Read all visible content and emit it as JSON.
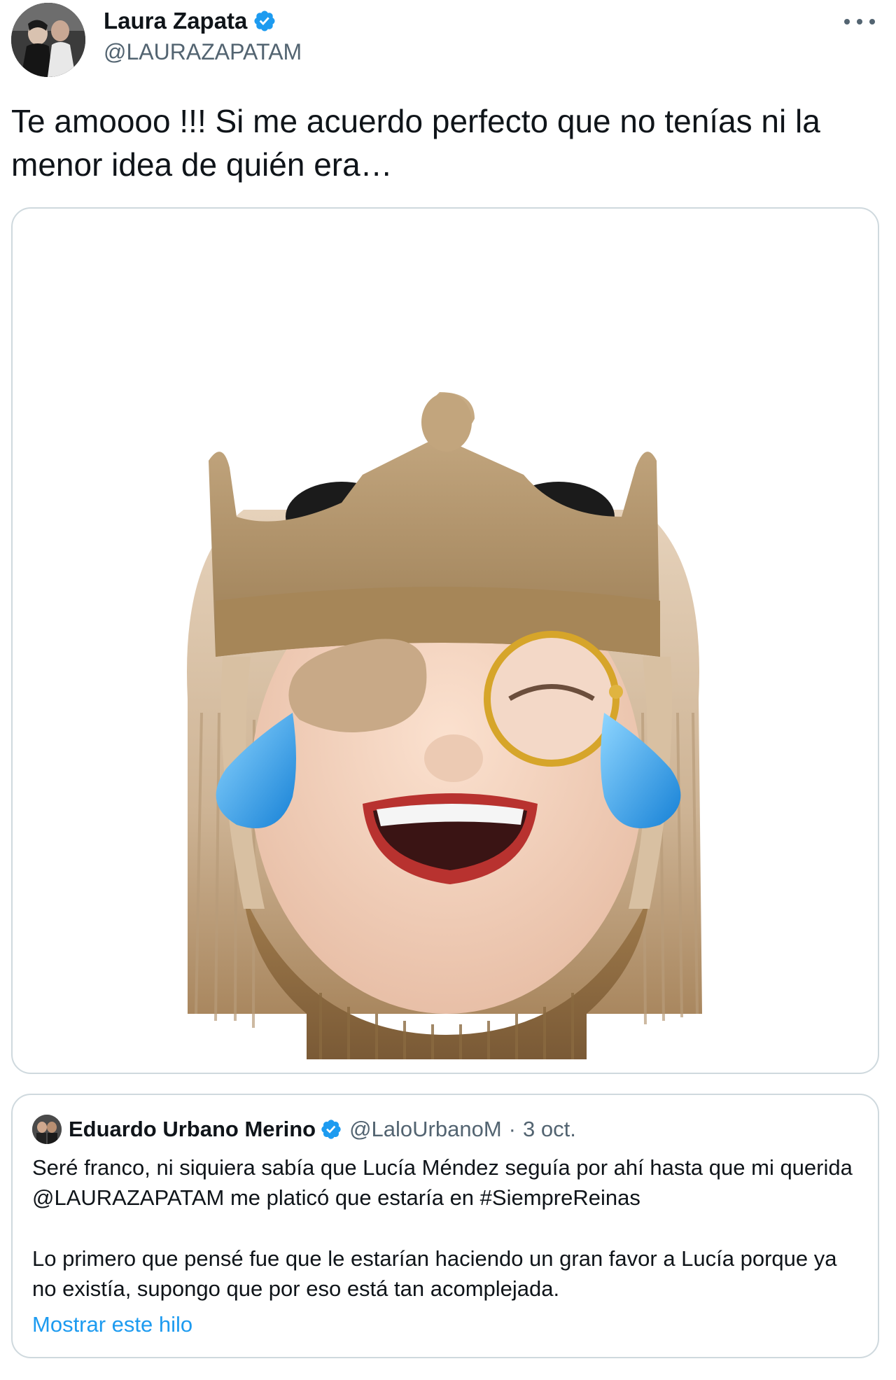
{
  "author": {
    "name": "Laura Zapata",
    "handle": "@LAURAZAPATAM",
    "verified": true,
    "verified_color": "#1d9bf0"
  },
  "icons": {
    "more": "more-options-icon",
    "verified": "verified-badge-icon"
  },
  "tweet": {
    "text": "Te amoooo !!! Si me acuerdo perfecto que no tenías ni la menor idea de quién era…"
  },
  "media": {
    "kind": "memoji-image",
    "description_icon": "crying-laughing-memoji"
  },
  "quoted_tweet": {
    "name": "Eduardo Urbano Merino",
    "handle": "@LaloUrbanoM",
    "separator": "·",
    "date": "3 oct.",
    "verified": true,
    "paragraph_1": "Seré franco, ni siquiera sabía que Lucía Méndez seguía por ahí hasta que mi querida @LAURAZAPATAM me platicó que estaría en #SiempreReinas",
    "paragraph_2": "Lo primero que pensé fue que le estarían haciendo un gran favor a Lucía porque ya no existía, supongo que por eso está tan acomplejada.",
    "show_thread_label": "Mostrar este hilo"
  },
  "colors": {
    "text": "#0f1419",
    "secondary": "#536471",
    "link": "#1d9bf0",
    "border": "#cfd9de"
  }
}
